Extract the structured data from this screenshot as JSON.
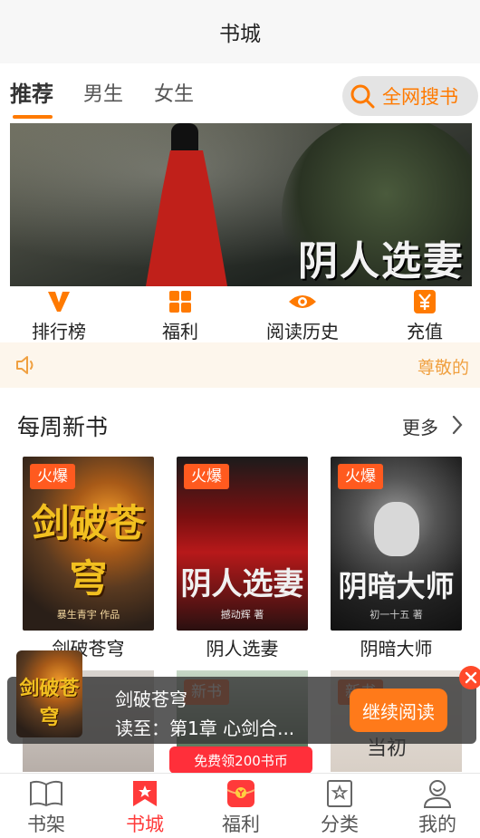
{
  "header": {
    "title": "书城"
  },
  "tabs": [
    {
      "label": "推荐",
      "active": true
    },
    {
      "label": "男生",
      "active": false
    },
    {
      "label": "女生",
      "active": false
    }
  ],
  "search": {
    "label": "全网搜书",
    "icon": "search-icon"
  },
  "banner": {
    "title": "阴人选妻"
  },
  "quick_nav": [
    {
      "label": "排行榜",
      "icon": "ranking-v-icon"
    },
    {
      "label": "福利",
      "icon": "grid-icon"
    },
    {
      "label": "阅读历史",
      "icon": "eye-icon"
    },
    {
      "label": "充值",
      "icon": "yen-icon"
    }
  ],
  "notice": {
    "text": "尊敬的",
    "icon": "speaker-icon"
  },
  "weekly": {
    "title": "每周新书",
    "more": "更多",
    "books": [
      {
        "name": "剑破苍穹",
        "badge": "火爆",
        "cover_text": "剑破苍穹",
        "cover_sub": "暴生青宇 作品"
      },
      {
        "name": "阴人选妻",
        "badge": "火爆",
        "cover_text": "阴人选妻",
        "cover_sub": "撼动辉 著"
      },
      {
        "name": "阴暗大师",
        "badge": "火爆",
        "cover_text": "阴暗大师",
        "cover_sub": "初一十五 著"
      }
    ],
    "row2": [
      {
        "badge": ""
      },
      {
        "badge": "新书"
      },
      {
        "badge": "新书",
        "cover_text": "当初"
      }
    ]
  },
  "continue_reading": {
    "title": "剑破苍穹",
    "progress": "读至：第1章 心剑合...",
    "button": "继续阅读",
    "thumb_text": "剑破苍穹"
  },
  "coin_banner": {
    "text": "免费领200书币"
  },
  "bottom_nav": [
    {
      "label": "书架",
      "icon": "book-icon",
      "active": false
    },
    {
      "label": "书城",
      "icon": "bookmark-star-icon",
      "active": true
    },
    {
      "label": "福利",
      "icon": "red-envelope-icon",
      "active": false
    },
    {
      "label": "分类",
      "icon": "category-icon",
      "active": false
    },
    {
      "label": "我的",
      "icon": "user-icon",
      "active": false
    }
  ],
  "colors": {
    "accent": "#ff7a00",
    "active_red": "#ff3a3a",
    "badge": "#ff5a1f"
  }
}
